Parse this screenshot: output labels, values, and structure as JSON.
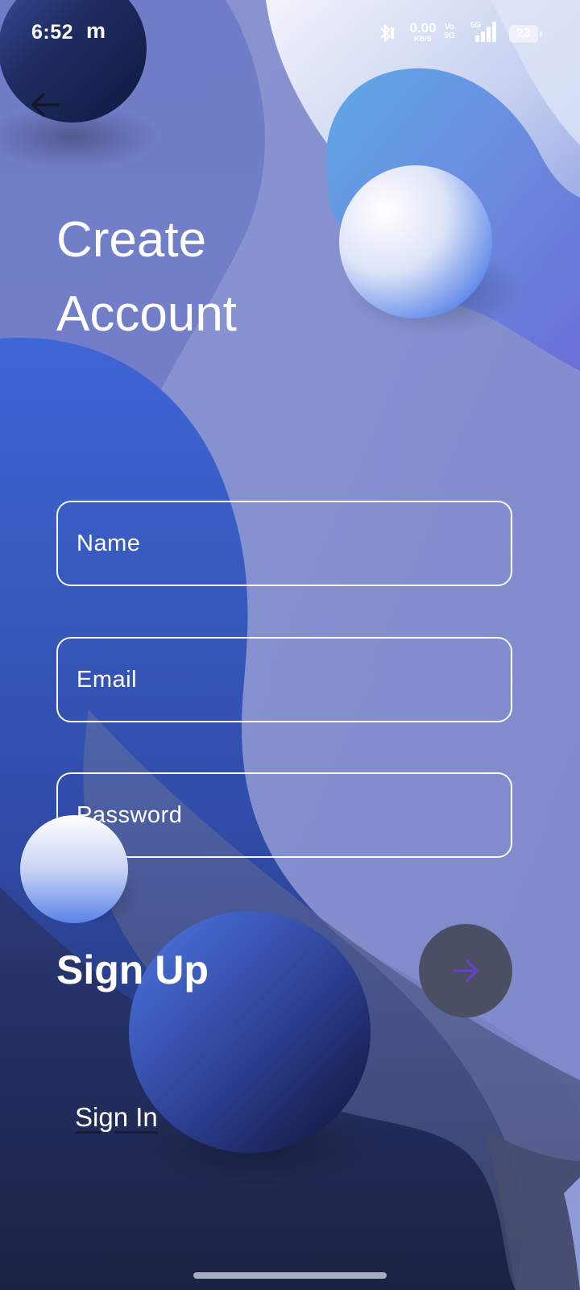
{
  "status_bar": {
    "time": "6:52",
    "app_icon": "m",
    "network_speed": "0.00",
    "network_speed_unit": "KB/S",
    "volte_top": "Vo",
    "volte_bottom": "5G",
    "network_type": "5G",
    "battery": "23",
    "icons": [
      "bluetooth-icon",
      "signal-icon",
      "battery-icon"
    ]
  },
  "header": {
    "back_icon": "arrow-left-icon",
    "title_line1": "Create",
    "title_line2": "Account"
  },
  "form": {
    "name_placeholder": "Name",
    "email_placeholder": "Email",
    "password_placeholder": "Password",
    "name_value": "",
    "email_value": "",
    "password_value": ""
  },
  "actions": {
    "signup_label": "Sign Up",
    "submit_icon": "arrow-right-icon",
    "signin_label": "Sign In"
  },
  "colors": {
    "background": "#7280c6",
    "accent_blue": "#3f63d0",
    "dark_navy": "#1b2446",
    "submit_button": "#4b4f63",
    "submit_arrow": "#6a3fd0"
  }
}
